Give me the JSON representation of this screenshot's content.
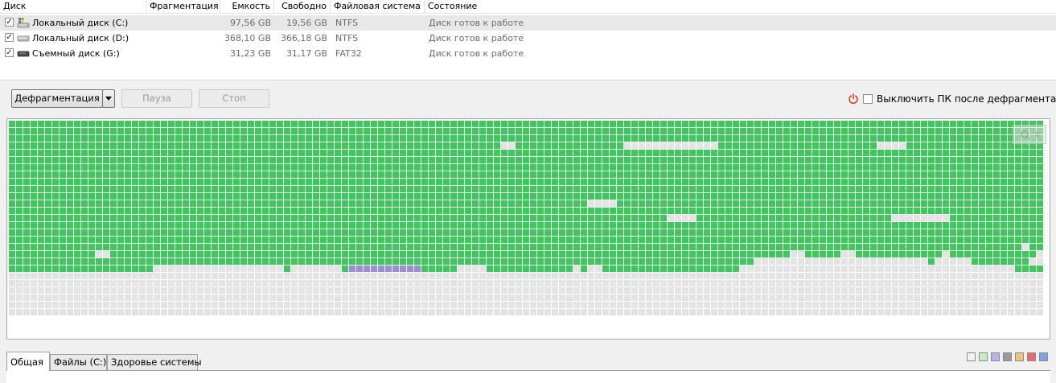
{
  "table": {
    "columns": [
      {
        "label": "Диск"
      },
      {
        "label": "Фрагментация"
      },
      {
        "label": "Емкость"
      },
      {
        "label": "Свободно"
      },
      {
        "label": "Файловая система"
      },
      {
        "label": "Состояние"
      }
    ],
    "rows": [
      {
        "checked": true,
        "icon": "system-drive-icon",
        "name": "Локальный диск (C:)",
        "fragmentation": "",
        "capacity": "97,56 GB",
        "free": "19,56 GB",
        "fs": "NTFS",
        "status": "Диск готов к работе",
        "selected": true
      },
      {
        "checked": true,
        "icon": "hard-drive-icon",
        "name": "Локальный диск (D:)",
        "fragmentation": "",
        "capacity": "368,10 GB",
        "free": "366,18 GB",
        "fs": "NTFS",
        "status": "Диск готов к работе",
        "selected": false
      },
      {
        "checked": true,
        "icon": "removable-drive-icon",
        "name": "Съемный диск (G:)",
        "fragmentation": "",
        "capacity": "31,23 GB",
        "free": "31,17 GB",
        "fs": "FAT32",
        "status": "Диск готов к работе",
        "selected": false
      }
    ]
  },
  "toolbar": {
    "defrag_label": "Дефрагментация",
    "pause_label": "Пауза",
    "stop_label": "Стоп",
    "shutdown_label": "Выключить ПК после дефрагментации",
    "shutdown_checked": false
  },
  "cluster_map": {
    "colors": {
      "used": "#3cc85a",
      "free": "#e3e3e3",
      "highlight": "#9a8fd6"
    },
    "rows": [
      "GGGGGGGGGGGGGGGGGGGGGGGGGGGGGGGGGGGGGGGGGGGGGGGGGGGGGGGGGGGGGGGGGGGGGGGGGGGGGGGGGGGGGGGGGGGGGGGGGGGGGGGGGGGGGGGGGGGGGGGGGGGGGGGGGGGGGGGGGGGGGGGGGGGGGGG",
      "GGGGGGGGGGGGGGGGGGGGGGGGGGGGGGGGGGGGGGGGGGGGGGGGGGGGGGGGGGGGGGGGGGGGGGGGGGGGGGGGGGGGGGGGGGGGGGGGGGGGGGGGGGGGGGGGGGGGGGGGGGGGGGGGGGGGGGGGGGGGGGGGGGGGGG",
      "GGGGGGGGGGGGGGGGGGGGGGGGGGGGGGGGGGGGGGGGGGGGGGGGGGGGGGGGGGGGGGGGGGGGGGGGGGGGGGGGGGGGGGGGGGGGGGGGGGGGGGGGGGGGGGGGGGGGGGGGGGGGGGGGGGGGGGGGGGGGGGGGGGGGGG",
      "GGGGGGGGGGGGGGGGGGGGGGGGGGGGGGGGGGGGGGGGGGGGGGGGGGGGGGGGGGGGGGGGGGGGGGFFGGGGGGGGGGGGGGFFFFFFFFFFFFFGGGGGGGGGGGGGGGGGGGGGGFFFFGGGGGGGGGGGGGGGGGGGGGGGGGGGGGGGGG",
      "GGGGGGGGGGGGGGGGGGGGGGGGGGGGGGGGGGGGGGGGGGGGGGGGGGGGGGGGGGGGGGGGGGGGGGGGGGGGGGGGGGGGGGGGGGGGGGGGGGGGGGGGGGGGGGGGGGGGGGGGGGGGGGGGGGGGGGGGGGGGGGGGGGGGGG",
      "GGGGGGGGGGGGGGGGGGGGGGGGGGGGGGGGGGGGGGGGGGGGGGGGGGGGGGGGGGGGGGGGGGGGGGGGGGGGGGGGGGGGGGGGGGGGGGGGGGGGGGGGGGGGGGGGGGGGGGGGGGGGGGGGGGGGGGGGGGGGGGGGGGGGGG",
      "GGGGGGGGGGGGGGGGGGGGGGGGGGGGGGGGGGGGGGGGGGGGGGGGGGGGGGGGGGGGGGGGGGGGGGGGGGGGGGGGGGGGGGGGGGGGGGGGGGGGGGGGGGGGGGGGGGGGGGGGGGGGGGGGGGGGGGGGGGGGGGGGGGGGGG",
      "GGGGGGGGGGGGGGGGGGGGGGGGGGGGGGGGGGGGGGGGGGGGGGGGGGGGGGGGGGGGGGGGGGGGGGGGGGGGGGGGGGGGGGGGGGGGGGGGGGGGGGGGGGGGGGGGGGGGGGGGGGGGGGGGGGGGGGGGGGGGGGGGGGGGGG",
      "GGGGGGGGGGGGGGGGGGGGGGGGGGGGGGGGGGGGGGGGGGGGGGGGGGGGGGGGGGGGGGGGGGGGGGGGGGGGGGGGGGGGGGGGGGGGGGGGGGGGGGGGGGGGGGGGGGGGGGGGGGGGGGGGGGGGGGGGGGGGGGGGGGGGGG",
      "GGGGGGGGGGGGGGGGGGGGGGGGGGGGGGGGGGGGGGGGGGGGGGGGGGGGGGGGGGGGGGGGGGGGGGGGGGGGGGGGGGGGGGGGGGGGGGGGGGGGGGGGGGGGGGGGGGGGGGGGGGGGGGGGGGGGGGGGGGGGGGGGGGGGGG",
      "GGGGGGGGGGGGGGGGGGGGGGGGGGGGGGGGGGGGGGGGGGGGGGGGGGGGGGGGGGGGGGGGGGGGGGGGGGGGGGGGGGGGGGGGGGGGGGGGGGGGGGGGGGGGGGGGGGGGGGGGGGGGGGGGGGGGGGGGGGGGGGGGGGGGGG",
      "GGGGGGGGGGGGGGGGGGGGGGGGGGGGGGGGGGGGGGGGGGGGGGGGGGGGGGGGGGGGGGGGGGGGGGGGGGGGGGGGGGGGGGGGGGGGGGGGGGGGGGGGGGGGGGGGGGGGGGGGGGGGGGGGGGGGGGGGGGGGGGGGGGGGGG",
      "GGGGGGGGGGGGGGGGGGGGGGGGGGGGGGGGGGGGGGGGGGGGGGGGGGGGGGGGGGGGGGGGGGGGGGGGGGGGGGGGGGGGGGGGGGGGGGGGGGGGGGGGGGGGGGGGGGGGGGGGGGGGGGGGGGGGGGGGGGGGGGGGGGGGGG",
      "GGGGGGGGGGGGGGGGGGGGGGGGGGGGGGGGGGGGGGGGGGGGGGGGGGGGGGGGGGGGGGGGGGGGGGGGGGGGGGGGGGGGGGGGGGGGGGGGGGGGGGGGGGGGGGGGGGGGGGGGGGGGGGGGGGGGGGGGGGGGGGGGGGGGGG",
      "GGGGGGGGGGGGGGGGGGGGGGGGGGGGGGGGGGGGGGGGGGGGGGGGGGGGGGGGGGGGGGGGGGGGGGGGGGGGGGGGGGGGGGGGGGGGGGGGGGGGGGGGGGGGGGGGGGGGGGGGGGGGGGGGGGGGGGGGGGGGGGGGGGGGG",
      "GGGGGGGGGGGGGGGGGGGGGGGGGGGGGGGGGGGGGGGGGGGGGGGGGGGGGGGGGGGGGGGGGGGGGGGGGGGGGGGGGGGGGGGGGGGGGGGGGGGGGGGGGGGGGGGGGGGGGGGGGGGGGGGGGGGGGGGGGGGGGGGGGGGGGG",
      "GGGGGGGGGGGGGGGGGGGGGGGGGGGGGGGGGGGGGGGGGGGGGGGGGGGGGGGGGGGGGGGGGGGGGGGGGGGGGGGGGGGGGGGGGGGGGGGGGGGGGGGGGGGGGGGGGGGGGGGGGGGGGGGGGGGGGGGGGGGGGGGGGGGGG",
      "GGGGGGGGGGGGGGGGGGGGGGGGGGGGGGGGGGGGGGGGGGGGGGGGGGGGGGGGGGGGGGGGGGGGGGGGGGGGGGGGGGGGGGGGGGGGGGGGGGGGGGGGGGGGGGGGGGGGGGGGGGGGGGGGGGGGGGGGGGGGGGGGGGGGG",
      "GGGGGGGGGGGGGGGGGGGGGGGGGGGGGGGGGGGGGGGGGGGGGGGGGGGGGGGGGGGGGGGGGGGGGGGGGGGGGGGGGGGGGGGGGGGGGGGGGGGGGGGGGGGGGGGGGGGGGGGGGGGGGGGGGGGGGGGGGGGGGGGGGGGGG",
      "GGGGGGGGGGGGGGGGGGGGGGGGGGGGGGGGGGGGGGGGGGGGGGGGGGGGGGGGGGGGGGGGGGGGGGGGGGGGGGGGGGGGGGGGGGGGGGGGGGGGGGGGGGGGGGGGGGGGGGGGGGGGGGGGGGGGGGGGGGGGGGGGGGGGG",
      "GGGGGGGGGGGGGGGGGGGGGGGGGGGGGGGGGGGGGGGGGGGGGGGGGGGGGGGGGGGGGGGGGGGGGGGGGGGGGGGGGGGGGGGGGGGGGGGGGGGGGGGGGGGGGGGGGGGGGGGGGGGGGGGGGGGGGGGGGGGGGGGGGGGGGG",
      "GGGGGGGGGGGGGGGGGGGGGGGGGGGGGGGGGGGGGGGGGGGGGGGGGGGGGGGGGGGGGGGGGGGGGGGGGGGGGGGGGGGGGGGGGGGGGGGGGGGGGGGGGGGGGGGGGGGGGGGGGGGGGGGGGGGGGGGGGGGGGGGGGGGGGG",
      "GGGGGGGGGGGGGGGGGGGGGGGGGGGGGGGGGGGGGGGGGGGGGGGGGGGGGGGGGGGGGGGGGGGGGGGGGGGGGGGGGGGGGGGGGGGGGGGGGGGGGGGGGGGGGGGGGGGGGGGGGGGGGGGGGGGGGGGGGGGGGGGGGGGGGG",
      "GGGGGGGGGGGGGGGGGGGGGGGGGGGGGGGGGGGGGGGGGGGGGGGGGGGGGGGGGGGGGGGGGGGGGGGGGGGGGGGGGGGGGGGGGGGGGGGGGGGGGGGGGGGGGGGGGGGGGGGGGGGGGGGGGGGGGGGGGGGGGGGGGGGGGG",
      "GGGGGGGGGGGGGGGGGGGGGGGGGGGGGGGGGGGGGGGGGGGGGGGGGGGGGGGGGGGGGGGGGGGGGGGGGGGGGGGGGGGGGGGGGGGGGGGGGGGGGGGGGGGGGGGGGGGGGGGGGGGGGGGGGGGGGGGGGGGGGGGGGGGGGG",
      "GGGGGGGGGGGGGGGGGGGGGGGGGGGGGGGGGGGGGGGGGGGGGGGGGGGGGGGGGGGGGGGGGGGGGGGGGGGGGGGGGGGGGGGGGGGGGGGGGGGGGGGGGGGGGGGGGGGGGGGGGGGGGGGGGGGGGGGGGGGGGGGGGGGGGG",
      "GGGGGGGGGGGGGGGGGGGGGGGGGGGGGGGGGGGGGGGGGGGGGGGGGGGGGGGGGGGGGGGGGGGGGGGGGGGGGGGGGGGGGGGGGGGGGGGGGGGGGGGGGGGGGGGGGGGGGGGGGGGGGGGGGGGGGGGGGGGGGGGGGGGGGG",
      "GGGGGGGGGGGGGGGGGGGGGGGGGGGGGGGGGGGGGGGGGGGGGGGGGGGGGGGGGGGGGGGGGGGGGGGGGGGGGGGGGGGGGGGGGGGGGGGGGGGGGGGGGGGGGGGGGGGGGGGGGGGGGGGGGGGGGGGGGGGGGGGGGGGGGG",
      "GGGGGGGGGGGGGGGGGGGGGGGGGGGGGGGGGGGGGGGGGGGGGGGGGGGGGGGGGGGGGGGGGGGGGGGGGGGGGGGGGGGGGGGGGGGGGGGGGGGGGGGGGGGGGGGGGGGGGGGGGGGGGGGGGGGGGGGGGGGGGGGGGGGGGG",
      "GGGGGGGGGGGGGGGGGGGGGGGGGGGGGGGGGGGGGGGGGGGGGGGGGGGGGGGGGGGGGGGGGGGGGGGGGGGGGGGGGGGGGGGGGGGGGGGGGGGGGGGGGGGGGGGGGGGGGGGGGGGGGGGGGGGGGGGGGGGGGGGGGGGGGG",
      "GGGGGGGGGGGGGGGGGGGGGGGGGGGGGGGGGGGGGGGGGGGGGGGGGGGGGGGGGGGGGGGGGGGGGGGGGGGGGGGGGGGGGGGGGGGGGGGGGGGGGGGGGGGGGGGGGGGGGGGGGGGGGGGGGGGGGGGGGGGGGGGGGGGGGG",
      "GGGGGGGGGGGGGGGGGGGGGGGGGGGGGGGGGGGGGGGGGGGGGGGGGGGGGGGGGGGGGGGGGGGGGGGGGGGGGGGGGGGGGGGGGGGGGGGGGGGGGGGGGGGGGGGGGGGGGGGGGGGGGGGGGGGGGGGGGGGGGGGGGGGGGG",
      "GGGGGGGGGGGGGGGGGGGGGGGGGGGGGGGGGGGGGGGGGGGGGGGGGGGGGGGGGGGGGGGGGGGGGGGGGGGGGGGGGGGGGGGGGGGGGGGGGGGGGGGGGGGGGGGGGGGGGGGGGGGGGGGGGGGGGGGGGGGGGGGGGGGGGG"
    ],
    "rows_explicit": [
      "GGGGGGGGGGGGGGGGGGGGGGGGGGGGGGGGGGGGGGGGGGGGGGGGGGGGGGGGGGGGGGGGGGGGGGGGGGGGGGGGGGGGGGGGGGGGGGGGGGGGGGGGGGGGGGGGGGGGGGGGGGGGGGGGGGGGGGGGGGGGGGGGGGGGGG",
      "GGGGGGGGGGGGGGGGGGGGGGGGGGGGGGGGGGGGGGGGGGGGGGGGGGGGGGGGGGGGGGGGGGGGGGGGGGGGGGGGGGGGGGGGGGGGGGGGGGGGGGGGGGGGGGGGGGGGGGGGGGGGGGGGGGGGGGGGGGGGGGGGGGGGG",
      "GGGGGGGGGGGGGGGGGGGGGGGGGGGGGGGGGGGGGGGGGGGGGGGGGGGGGGGGGGGGGGGGGGGGGGGGGGGGGGGGGGGGGGGGGGGGGGGGGGGGGGGGGGGGGGGGGGGGGGGGGGGGGGGGGGGGGGGGGGGGGGGGGGGGG",
      "GGGGGGGGGGGGGGGGGGGGGGGGGGGGGGGGGGGGGGGGGGGGGGGGGGGGGGGGGGGGGGGGGGGGFFGGGGGGGGGGGGGGGFFFFFFFFFFFFFGGGGGGGGGGGGGGGGGGGGGGFFFFGGGGGGGGGGGGGGGGGGGGGGGGGGGGGGG",
      "GGGGGGGGGGGGGGGGGGGGGGGGGGGGGGGGGGGGGGGGGGGGGGGGGGGGGGGGGGGGGGGGGGGGGGGGGGGGGGGGGGGGGGGGGGGGGGGGGGGGGGGGGGGGGGGGGGGGGGGGGGGGGGGGGGGGGGGGGGGGGGGGGGGGG",
      "GGGGGGGGGGGGGGGGGGGGGGGGGGGGGGGGGGGGGGGGGGGGGGGGGGGGGGGGGGGGGGGGGGGGGGGGGGGGGGGGGGGGGGGGGGGGGGGGGGGGGGGGGGGGGGGGGGGGGGGGGGGGGGGGGGGGGGGGGGGGGGGGGGGGG",
      "GGGGGGGGGGGGGGGGGGGGGGGGGGGGGGGGGGGGGGGGGGGGGGGGGGGGGGGGGGGGGGGGGGGGGGGGGGGGGGGGGGGGGGGGGGGGGGGGGGGGGGGGGGGGGGGGGGGGGGGGGGGGGGGGGGGGGGGGGGGGGGGGGGGGG",
      "GGGGGGGGGGGGGGGGGGGGGGGGGGGGGGGGGGGGGGGGGGGGGGGGGGGGGGGGGGGGGGGGGGGGGGGGGGGGGGGGGGGGGGGGGGGGGGGGGGGGGGGGGGGGGGGGGGGGGGGGGGGGGGGGGGGGGGGGGGGGGGGGGGGGG",
      "GGGGGGGGGGGGGGGGGGGGGGGGGGGGGGGGGGGGGGGGGGGGGGGGGGGGGGGGGGGGGGGGGGGGGGGGGGGGGGGGGGGGGGGGGGGGGGGGGGGGGGGGGGGGGGGGGGGGGGGGGGGGGGGGGGGGGGGGGGGGGGGGGGGGG",
      "GGGGGGGGGGGGGGGGGGGGGGGGGGGGGGGGGGGGGGGGGGGGGGGGGGGGGGGGGGGGGGGGGGGGGGGGGGGGGGGGGGGGGGGGGGGGGGGGGGGGGGGGGGGGGGGGGGGGGGGGGGGGGGGGGGGGGGGGGGGGGGGGGGGGG",
      "GGGGGGGGGGGGGGGGGGGGGGGGGGGGGGGGGGGGGGGGGGGGGGGGGGGGGGGGGGGGGGGGGGGGGGGGGGGGGGGGGGGGGGGGGGGGGGGGGGGGGGGGGGGGGGGGGGGGGGGGGGGGGGGGGGGGGGGGGGGGGGGGGGGGG",
      "GGGGGGGGGGGGGGGGGGGGGGGGGGGGGGGGGGGGGGGGGGGGGGGGGGGGGGGGGGGGGGGGGGGGGGGGGGGGGGGGFFFFGGGGGGGGGGGGGGGGGGGGGGGGGGGGGGGGGGGGGGGGGGGGGGGGGGGGGGGGGGGGGGGGGGGG",
      "GGGGGGGGGGGGGGGGGGGGGGGGGGGGGGGGGGGGGGGGGGGGGGGGGGGGGGGGGGGGGGGGGGGGGGGGGGGGGGGGGGGGGGGGGGGGGGGGGGGGGGGGGGGGGGGGGGGGGGGGGGGGGGGGGGGGGGGGGGGGGGGGGGGGG",
      "GGGGGGGGGGGGGGGGGGGGGGGGGGGGGGGGGGGGGGGGGGGGGGGGGGGGGGGGGGGGGGGGGGGGGGGGGGGGGGGGGGGGGGGGGGGFFFFGGGGGGGGGGGGGGGGGGGGGGGGGGGFFFFFFFFGGGGGGGGGGGGGGGGGGGGG",
      "GGGGGGGGGGGGGGGGGGGGGGGGGGGGGGGGGGGGGGGGGGGGGGGGGGGGGGGGGGGGGGGGGGGGGGGGGGGGGGGGGGGGGGGGGGGGGGGGGGGGGGGGGGGGGGGGGGGGGGGGGGGGGGGGGGGGGGGGGGGGGGGGGGGGG",
      "GGGGGGGGGGGGGGGGGGGGGGGGGGGGGGGGGGGGGGGGGGGGGGGGGGGGGGGGGGGGGGGGGGGGGGGGGGGGGGGGGGGGGGGGGGGGGGGGGGGGGGGGGGGGGGGGGGGGGGGGGGGGGGGGGGGGGGGGGGGGGGGGGGGGG",
      "GGGGGGGGGGGGGGGGGGGGGGGGGGGGGGGGGGGGGGGGGGGGGGGGGGGGGGGGGGGGGGGGGGGGGGGGGGGGGGGGGGGGGGGGGGGGGGGGGGGGGGGGGGGGGGGGGGGGGGGGGGGGGGGGGGGGGGGGGGGGGGGGGGGGG",
      "GGGGGGGGGGGGGGGGGGGGGGGGGGGGGGGGGGGGGGGGGGGGGGGGGGGGGGGGGGGGGGGGGGGGGGGGGGGGGGGGGGGGGGGGGGGGGGGGGGGGGGGGGGGGGGGGGGGGGGGGGGGGGGGGGGGGGGGGGGGGFGGGGGGGGGGGG",
      "GGGGGGGGGGGGFFGGGGGGGGGGGGGGGGGGGGGGGGGGGGGGGGGGGGGGGGGGGGGGGGGGGGGGGGGGGGGGGGGGGGGGGGGGGGGGGGGGGGGGGGGGGGGGFFGGGGGFFGGGGGGGGGGGGFGGGGGGGGGGGGFGGGGGGGGGGGG",
      "GGGGGGGGGGGGGGGGGGGGGGGGGGGGGGGGGGGGGGGGGGGGGGGGGGGGGGGGGGGGGGGGGGGGGGGGGGGGGGGGGGGGGGGGGGGGGGGGGGGGGGGFFFFFFFFFFFFFFFFFFFFFFFFGFFFFFGGGGGGGGFFFFFFFFFGG",
      "GGGGGGGGGGGGGGGGGGGGFFFFFFFFFFFFFFFFFFGFFFFFFFGPPPPPPPPPPGGGGGFFFFGGGGGGGGGGGGFGFFGGGGGGGGGGGGGGGGGGGFFFFFFFFFFFFFFFFFFFFFFFFFFFFFFFFFFFFFFGGGGGGGFFFGFFFFFGG",
      "FFFFFFFFFFFFFFFFFFFFFFFFFFFFFFFFFFFFFFFFFFFFFFFFFFFFFFFFFFFFFFFFFFFFFFFFFFFFFFFFFFFFFFFFFFFFFFFFFFFFFFFFFFFFFFFFFFFFFFFFFFFFFFFFFFFFFFFFFFFFFFFFFFFFFFFFFF",
      "FFFFFFFFFFFFFFFFFFFFFFFFFFFFFFFFFFFFFFFFFFFFFFFFFFFFFFFFFFFFFFFFFFFFFFFFFFFFFFFFFFFFFFFFFFFFFFFFFFFFFFFFFFFFFFFFFFFFFFFFFFFFFFFFFFFFFFFFFFFFFFFFFFFFFFFFFFF",
      "FFFFFFFFFFFFFFFFFFFFFFFFFFFFFFFFFFFFFFFFFFFFFFFFFFFFFFFFFFFFFFFFFFFFFFFFFFFFFFFFFFFFFFFFFFFFFFFFFFFFFFFFFFFFFFFFFFFFFFFFFFFFFFFFFFFFFFFFFFFFFFFFFFFFFFFFFFF",
      "FFFFFFFFFFFFFFFFFFFFFFFFFFFFFFFFFFFFFFFFFFFFFFFFFFFFFFFFFFFFFFFFFFFFFFFFFFFFFFFFFFFFFFFFFFFFFFFFFFFFFFFFFFFFFFFFFFFFFFFFFFFFFFFFFFFFFFFFFFFFFFFFFFFFFFFFFFF",
      "FFFFFFFFFFFFFFFFFFFFFFFFFFFFFFFFFFFFFFFFFFFFFFFFFFFFFFFFFFFFFFFFFFFFFFFFFFFFFFFFFFFFFFFFFFFFFFFFFFFFFFFFFFFFFFFFFFFFFFFFFFFFFFFFFFFFFFFFFFFFFFFFFFFFFFFFFFF",
      "FFFFFFFFFFFFFFFFFFFFFFFFFFFFFFFFFFFFFFFFFFFFFFFFFFFFFFFFFFFFFFFFFFFFFFFFFFFFFFFFFFFFFFFFFFFFFFFFFFFFFFFFFFFFFFFFFFFFFFFFFFFFFFFFFFFFFFFFFFFFFFFFFFFFFFFFFFF"
    ]
  },
  "tabs": {
    "items": [
      {
        "label": "Общая",
        "active": true
      },
      {
        "label": "Файлы (C:)",
        "active": false
      },
      {
        "label": "Здоровье системы",
        "active": false
      }
    ]
  },
  "legend": {
    "swatches": [
      {
        "name": "free-swatch",
        "color": "#f2f2f2"
      },
      {
        "name": "used-swatch",
        "color": "#c8eec0"
      },
      {
        "name": "fragmented-swatch",
        "color": "#b8b4e6"
      },
      {
        "name": "system-swatch",
        "color": "#9a9a9a"
      },
      {
        "name": "mft-swatch",
        "color": "#f0c080"
      },
      {
        "name": "locked-swatch",
        "color": "#e86a6a"
      },
      {
        "name": "moved-swatch",
        "color": "#7aa4e8"
      }
    ]
  }
}
